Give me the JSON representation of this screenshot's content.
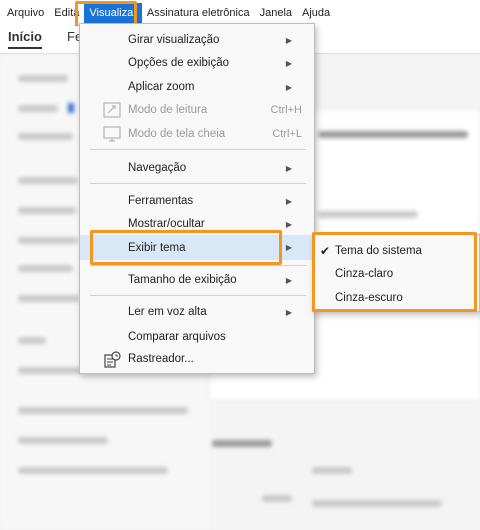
{
  "menubar": {
    "items": [
      {
        "label": "Arquivo"
      },
      {
        "label": "Edita"
      },
      {
        "label": "Visualizar"
      },
      {
        "label": "Assinatura eletrônica"
      },
      {
        "label": "Janela"
      },
      {
        "label": "Ajuda"
      }
    ],
    "active_index": 2
  },
  "tabs": [
    {
      "label": "Início"
    },
    {
      "label": "Fe"
    }
  ],
  "menu": {
    "items": [
      {
        "label": "Girar visualização",
        "has_submenu": true
      },
      {
        "label": "Opções de exibição",
        "has_submenu": true
      },
      {
        "label": "Aplicar zoom",
        "has_submenu": true
      },
      {
        "label": "Modo de leitura",
        "shortcut": "Ctrl+H",
        "disabled": true,
        "icon": "reading-mode-icon"
      },
      {
        "label": "Modo de tela cheia",
        "shortcut": "Ctrl+L",
        "disabled": true,
        "icon": "fullscreen-icon"
      },
      {
        "label": "Navegação",
        "has_submenu": true
      },
      {
        "label": "Ferramentas",
        "has_submenu": true
      },
      {
        "label": "Mostrar/ocultar",
        "has_submenu": true
      },
      {
        "label": "Exibir tema",
        "has_submenu": true,
        "selected": true
      },
      {
        "label": "Tamanho de exibição",
        "has_submenu": true
      },
      {
        "label": "Ler em voz alta",
        "has_submenu": true
      },
      {
        "label": "Comparar arquivos"
      },
      {
        "label": "Rastreador...",
        "icon": "tracker-icon"
      }
    ]
  },
  "submenu": {
    "items": [
      {
        "label": "Tema do sistema",
        "checked": true
      },
      {
        "label": "Cinza-claro"
      },
      {
        "label": "Cinza-escuro"
      }
    ]
  },
  "colors": {
    "accent": "#1a73d9",
    "highlight": "#f4951f",
    "selected_bg": "#d9e8f7"
  }
}
